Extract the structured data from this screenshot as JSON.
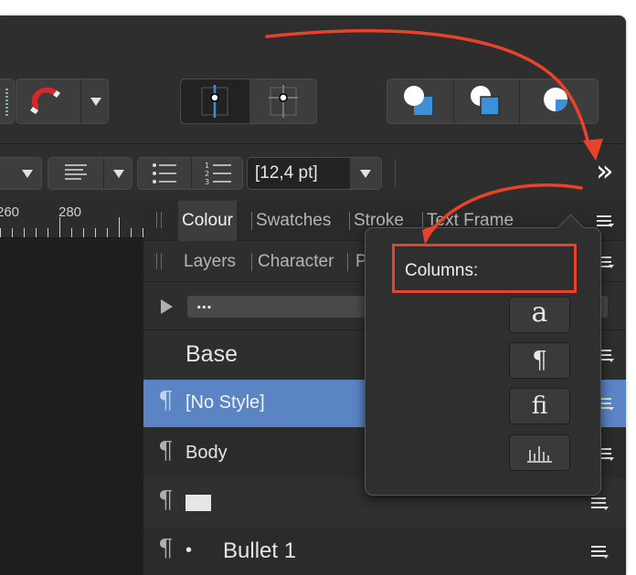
{
  "toolbar": {
    "line_spacing_value": "[12,4 pt]"
  },
  "ruler": {
    "ticks": [
      "260",
      "280"
    ]
  },
  "panel": {
    "tabs_row1": [
      "Colour",
      "Swatches",
      "Stroke",
      "Text Frame"
    ],
    "tabs_row2": [
      "Layers",
      "Character",
      "P"
    ],
    "search_value": "...",
    "styles": [
      {
        "label": "Base"
      },
      {
        "label": "[No Style]",
        "selected": true
      },
      {
        "label": "Body"
      },
      {
        "label": ""
      },
      {
        "label": "Bullet 1",
        "bullet": "•"
      }
    ]
  },
  "popup": {
    "title": "Columns:",
    "buttons": [
      "a",
      "¶",
      "ﬁ",
      ""
    ]
  },
  "overflow": {
    "label": "»"
  },
  "colors": {
    "annotation": "#e8432a",
    "selected_row": "#5b84c4",
    "accent_blue": "#3d8fd8"
  }
}
